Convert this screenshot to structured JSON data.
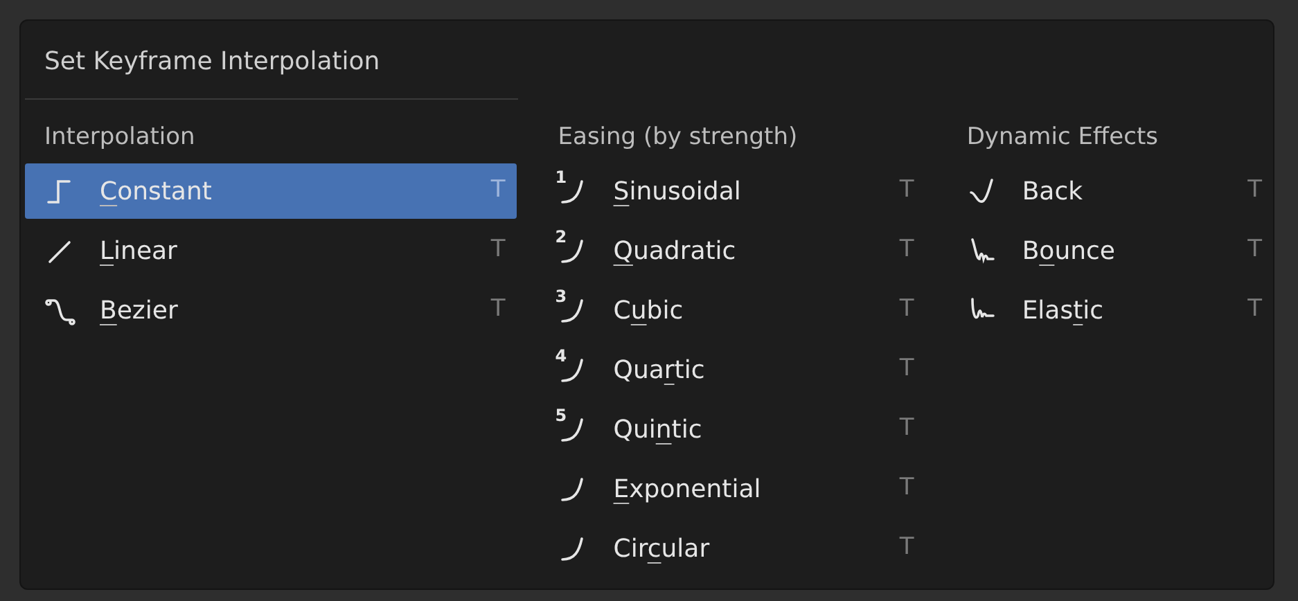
{
  "menu": {
    "title": "Set Keyframe Interpolation",
    "columns": [
      {
        "heading": "Interpolation",
        "items": [
          {
            "kind": "constant",
            "selected": true,
            "label": [
              {
                "text": "C",
                "underlined": true
              },
              {
                "text": "onstant",
                "underlined": false
              }
            ],
            "shortcut": "T"
          },
          {
            "kind": "linear",
            "selected": false,
            "label": [
              {
                "text": "L",
                "underlined": true
              },
              {
                "text": "inear",
                "underlined": false
              }
            ],
            "shortcut": "T"
          },
          {
            "kind": "bezier",
            "selected": false,
            "label": [
              {
                "text": "B",
                "underlined": true
              },
              {
                "text": "ezier",
                "underlined": false
              }
            ],
            "shortcut": "T"
          }
        ]
      },
      {
        "heading": "Easing (by strength)",
        "items": [
          {
            "kind": "ease",
            "number": "1",
            "selected": false,
            "label": [
              {
                "text": "S",
                "underlined": true
              },
              {
                "text": "inusoidal",
                "underlined": false
              }
            ],
            "shortcut": "T"
          },
          {
            "kind": "ease",
            "number": "2",
            "selected": false,
            "label": [
              {
                "text": "Q",
                "underlined": true
              },
              {
                "text": "uadratic",
                "underlined": false
              }
            ],
            "shortcut": "T"
          },
          {
            "kind": "ease",
            "number": "3",
            "selected": false,
            "label": [
              {
                "text": "C",
                "underlined": false
              },
              {
                "text": "u",
                "underlined": true
              },
              {
                "text": "bic",
                "underlined": false
              }
            ],
            "shortcut": "T"
          },
          {
            "kind": "ease",
            "number": "4",
            "selected": false,
            "label": [
              {
                "text": "Qua",
                "underlined": false
              },
              {
                "text": "r",
                "underlined": true
              },
              {
                "text": "tic",
                "underlined": false
              }
            ],
            "shortcut": "T"
          },
          {
            "kind": "ease",
            "number": "5",
            "selected": false,
            "label": [
              {
                "text": "Qui",
                "underlined": false
              },
              {
                "text": "n",
                "underlined": true
              },
              {
                "text": "tic",
                "underlined": false
              }
            ],
            "shortcut": "T"
          },
          {
            "kind": "ease",
            "selected": false,
            "label": [
              {
                "text": "E",
                "underlined": true
              },
              {
                "text": "xponential",
                "underlined": false
              }
            ],
            "shortcut": "T"
          },
          {
            "kind": "ease",
            "selected": false,
            "label": [
              {
                "text": "Cir",
                "underlined": false
              },
              {
                "text": "c",
                "underlined": true
              },
              {
                "text": "ular",
                "underlined": false
              }
            ],
            "shortcut": "T"
          }
        ]
      },
      {
        "heading": "Dynamic Effects",
        "items": [
          {
            "kind": "back",
            "selected": false,
            "label": [
              {
                "text": "Back",
                "underlined": false
              }
            ],
            "shortcut": "T"
          },
          {
            "kind": "bounce",
            "selected": false,
            "label": [
              {
                "text": "B",
                "underlined": false
              },
              {
                "text": "o",
                "underlined": true
              },
              {
                "text": "unce",
                "underlined": false
              }
            ],
            "shortcut": "T"
          },
          {
            "kind": "elastic",
            "selected": false,
            "label": [
              {
                "text": "Elas",
                "underlined": false
              },
              {
                "text": "t",
                "underlined": true
              },
              {
                "text": "ic",
                "underlined": false
              }
            ],
            "shortcut": "T"
          }
        ]
      }
    ]
  }
}
